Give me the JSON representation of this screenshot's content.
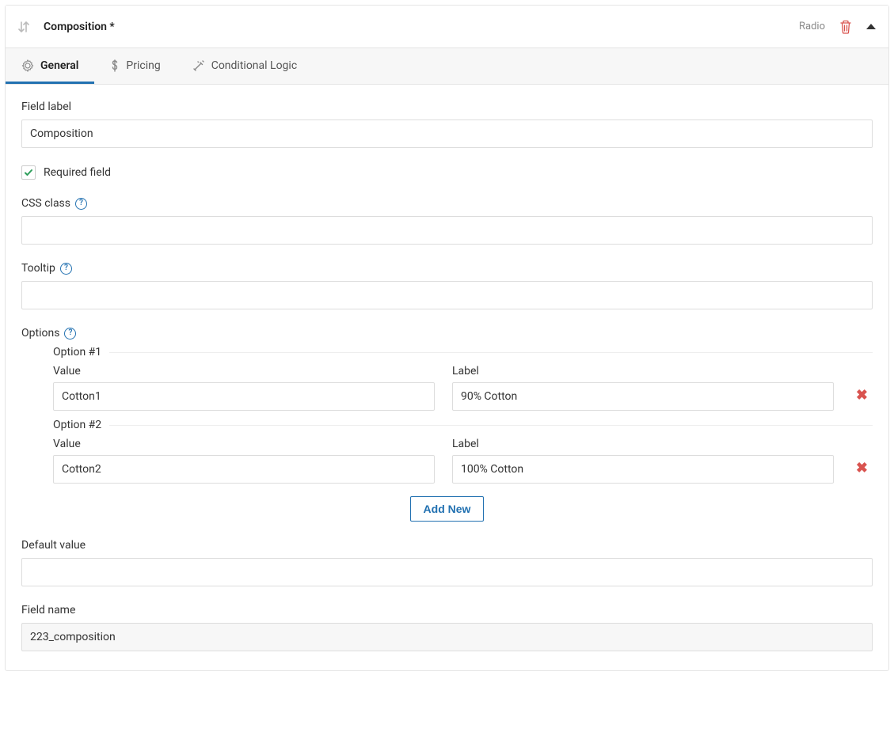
{
  "header": {
    "title": "Composition *",
    "type_label": "Radio"
  },
  "tabs": {
    "general": "General",
    "pricing": "Pricing",
    "conditional": "Conditional Logic"
  },
  "labels": {
    "field_label": "Field label",
    "required_field": "Required field",
    "css_class": "CSS class",
    "tooltip": "Tooltip",
    "options": "Options",
    "value": "Value",
    "label": "Label",
    "add_new": "Add New",
    "default_value": "Default value",
    "field_name": "Field name"
  },
  "values": {
    "field_label": "Composition",
    "required_checked": true,
    "css_class": "",
    "tooltip": "",
    "default_value": "",
    "field_name": "223_composition"
  },
  "options": [
    {
      "legend": "Option #1",
      "value": "Cotton1",
      "label": "90% Cotton"
    },
    {
      "legend": "Option #2",
      "value": "Cotton2",
      "label": "100% Cotton"
    }
  ]
}
